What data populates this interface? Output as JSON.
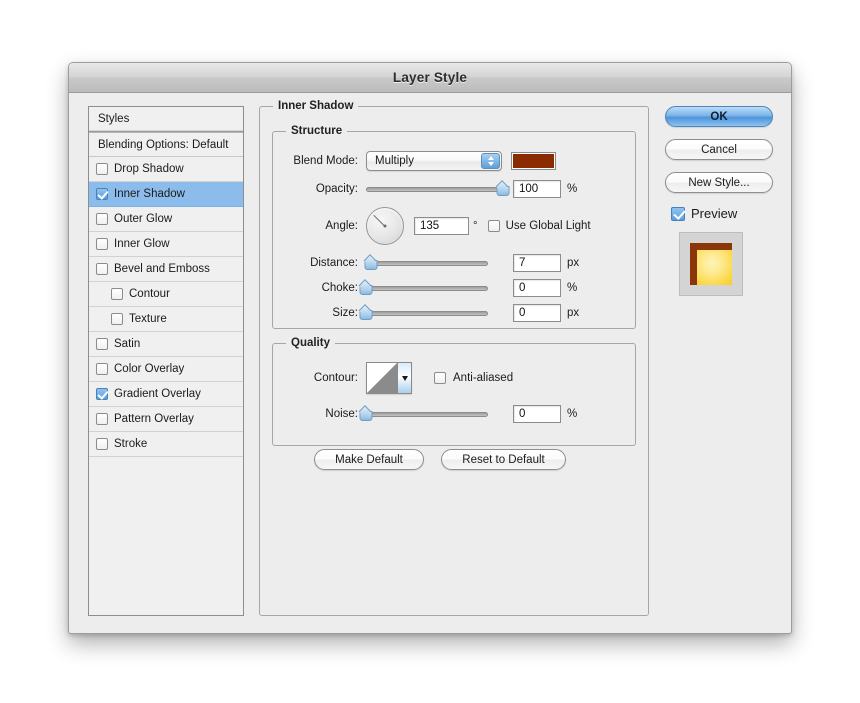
{
  "dialog": {
    "title": "Layer Style"
  },
  "sidebar": {
    "header": "Styles",
    "blending_options": "Blending Options: Default",
    "items": [
      {
        "label": "Drop Shadow",
        "checked": false,
        "selected": false,
        "indented": false
      },
      {
        "label": "Inner Shadow",
        "checked": true,
        "selected": true,
        "indented": false
      },
      {
        "label": "Outer Glow",
        "checked": false,
        "selected": false,
        "indented": false
      },
      {
        "label": "Inner Glow",
        "checked": false,
        "selected": false,
        "indented": false
      },
      {
        "label": "Bevel and Emboss",
        "checked": false,
        "selected": false,
        "indented": false
      },
      {
        "label": "Contour",
        "checked": false,
        "selected": false,
        "indented": true
      },
      {
        "label": "Texture",
        "checked": false,
        "selected": false,
        "indented": true
      },
      {
        "label": "Satin",
        "checked": false,
        "selected": false,
        "indented": false
      },
      {
        "label": "Color Overlay",
        "checked": false,
        "selected": false,
        "indented": false
      },
      {
        "label": "Gradient Overlay",
        "checked": true,
        "selected": false,
        "indented": false
      },
      {
        "label": "Pattern Overlay",
        "checked": false,
        "selected": false,
        "indented": false
      },
      {
        "label": "Stroke",
        "checked": false,
        "selected": false,
        "indented": false
      }
    ]
  },
  "main": {
    "section_title": "Inner Shadow",
    "structure": {
      "legend": "Structure",
      "blend_mode_label": "Blend Mode:",
      "blend_mode_value": "Multiply",
      "shadow_color": "#8a2b02",
      "opacity_label": "Opacity:",
      "opacity_value": "100",
      "opacity_unit": "%",
      "opacity_percent": 100,
      "angle_label": "Angle:",
      "angle_value": "135",
      "angle_unit": "°",
      "use_global_light_label": "Use Global Light",
      "use_global_light_checked": false,
      "distance_label": "Distance:",
      "distance_value": "7",
      "distance_unit": "px",
      "distance_percent": 4,
      "choke_label": "Choke:",
      "choke_value": "0",
      "choke_unit": "%",
      "choke_percent": 0,
      "size_label": "Size:",
      "size_value": "0",
      "size_unit": "px",
      "size_percent": 0
    },
    "quality": {
      "legend": "Quality",
      "contour_label": "Contour:",
      "anti_aliased_label": "Anti-aliased",
      "anti_aliased_checked": false,
      "noise_label": "Noise:",
      "noise_value": "0",
      "noise_unit": "%",
      "noise_percent": 0
    },
    "buttons": {
      "make_default": "Make Default",
      "reset_to_default": "Reset to Default"
    }
  },
  "rightcol": {
    "ok": "OK",
    "cancel": "Cancel",
    "new_style": "New Style...",
    "preview_label": "Preview",
    "preview_checked": true,
    "preview_fill_color": "#fcd94a",
    "preview_shadow_color": "#8a3608"
  }
}
